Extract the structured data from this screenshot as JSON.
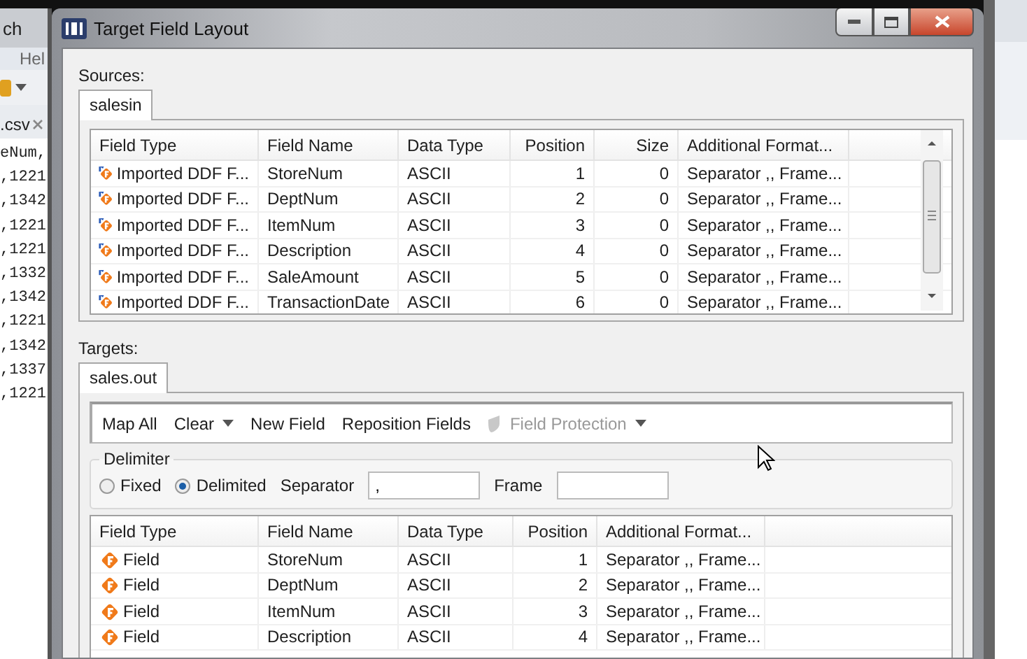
{
  "background_app": {
    "title": "ch",
    "menu": "Hel",
    "file_tab": ".csv",
    "code_lines": [
      "eNum,",
      ",1221",
      ",1342",
      ",1221",
      ",1221",
      ",1332",
      ",1342",
      ",1221",
      ",1342",
      ",1337",
      ",1221"
    ]
  },
  "window": {
    "title": "Target Field Layout"
  },
  "sources": {
    "label": "Sources:",
    "tabs": [
      {
        "label": "salesin",
        "selected": true
      }
    ],
    "table": {
      "columns": [
        "Field Type",
        "Field Name",
        "Data Type",
        "Position",
        "Size",
        "Additional Format..."
      ],
      "rows": [
        {
          "cells": [
            "Imported DDF F...",
            "StoreNum",
            "ASCII",
            "1",
            "0",
            "Separator ,, Frame..."
          ]
        },
        {
          "cells": [
            "Imported DDF F...",
            "DeptNum",
            "ASCII",
            "2",
            "0",
            "Separator ,, Frame..."
          ]
        },
        {
          "cells": [
            "Imported DDF F...",
            "ItemNum",
            "ASCII",
            "3",
            "0",
            "Separator ,, Frame..."
          ]
        },
        {
          "cells": [
            "Imported DDF F...",
            "Description",
            "ASCII",
            "4",
            "0",
            "Separator ,, Frame..."
          ]
        },
        {
          "cells": [
            "Imported DDF F...",
            "SaleAmount",
            "ASCII",
            "5",
            "0",
            "Separator ,, Frame..."
          ]
        },
        {
          "cells": [
            "Imported DDF F...",
            "TransactionDate",
            "ASCII",
            "6",
            "0",
            "Separator ,, Frame..."
          ]
        }
      ]
    }
  },
  "targets": {
    "label": "Targets:",
    "tabs": [
      {
        "label": "sales.out",
        "selected": true
      }
    ],
    "toolbar": [
      {
        "label": "Map All",
        "kind": "button",
        "disabled": false
      },
      {
        "label": "Clear",
        "kind": "dropdown",
        "disabled": false
      },
      {
        "label": "New Field",
        "kind": "button",
        "disabled": false
      },
      {
        "label": "Reposition Fields",
        "kind": "button",
        "disabled": false
      },
      {
        "label": "Field Protection",
        "kind": "menu",
        "disabled": true
      }
    ],
    "delimiter": {
      "label": "Delimiter",
      "options": [
        {
          "label": "Fixed",
          "selected": false
        },
        {
          "label": "Delimited",
          "selected": true
        }
      ],
      "separator": {
        "label": "Separator",
        "value": ","
      },
      "frame": {
        "label": "Frame"
      }
    },
    "table": {
      "columns": [
        "Field Type",
        "Field Name",
        "Data Type",
        "Position",
        "Additional Format..."
      ],
      "rows": [
        {
          "cells": [
            "Field",
            "StoreNum",
            "ASCII",
            "1",
            "Separator ,, Frame..."
          ]
        },
        {
          "cells": [
            "Field",
            "DeptNum",
            "ASCII",
            "2",
            "Separator ,, Frame..."
          ]
        },
        {
          "cells": [
            "Field",
            "ItemNum",
            "ASCII",
            "3",
            "Separator ,, Frame..."
          ]
        },
        {
          "cells": [
            "Field",
            "Description",
            "ASCII",
            "4",
            "Separator ,, Frame..."
          ]
        }
      ]
    }
  }
}
